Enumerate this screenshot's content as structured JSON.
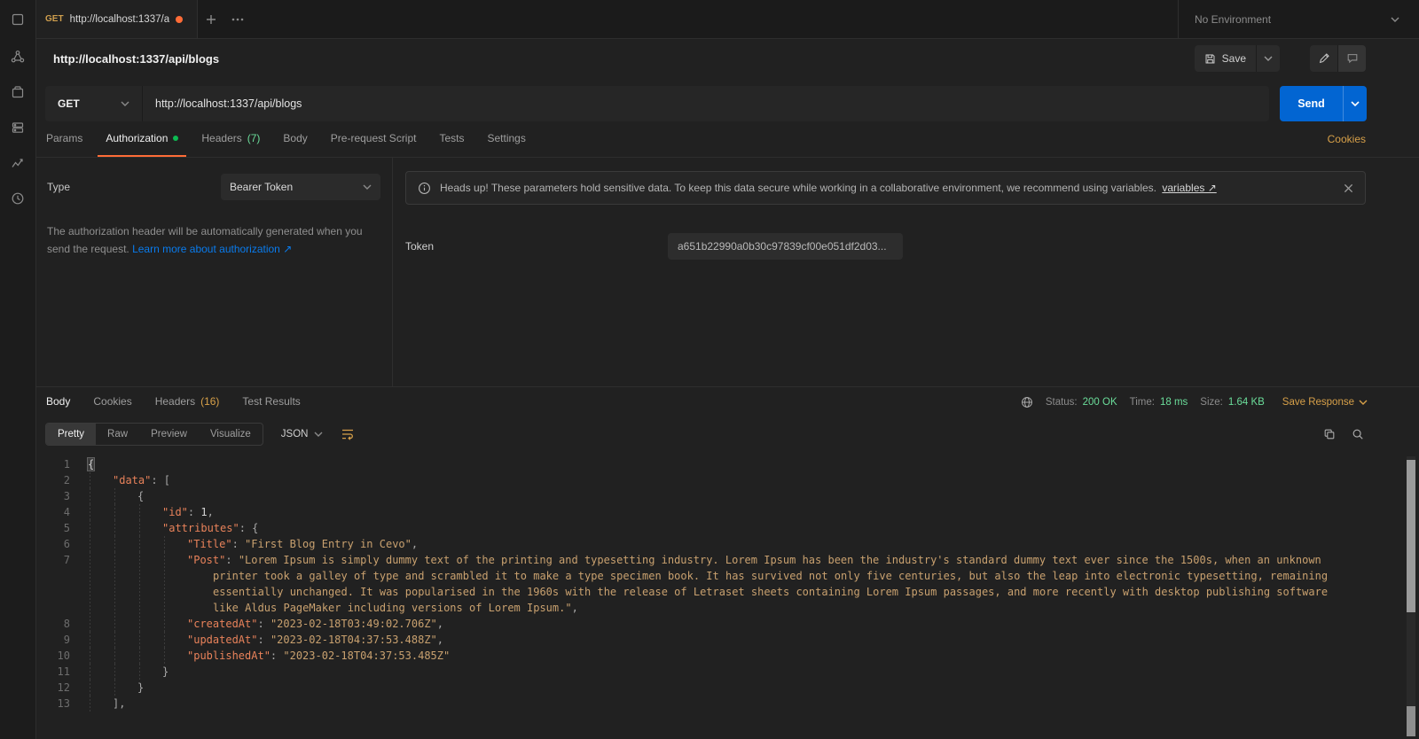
{
  "colors": {
    "accent_orange": "#ff6c37",
    "send_blue": "#0265d2",
    "status_green": "#6bdd9a",
    "link_blue": "#097bed",
    "link_amber": "#d7a049",
    "auth_dot_green": "#0cbb52"
  },
  "icons": [
    "collections-icon",
    "apis-icon",
    "environments-icon",
    "mock-servers-icon",
    "monitors-icon",
    "history-icon",
    "plus-icon",
    "more-options-icon",
    "chevron-down-icon",
    "save-icon",
    "edit-pencil-icon",
    "comments-icon",
    "info-icon",
    "close-icon",
    "globe-icon",
    "wrap-text-icon",
    "copy-icon",
    "search-icon"
  ],
  "topbar": {
    "tab_method": "GET",
    "tab_title": "http://localhost:1337/a",
    "environment": "No Environment"
  },
  "request": {
    "name": "http://localhost:1337/api/blogs",
    "save_label": "Save",
    "method": "GET",
    "url": "http://localhost:1337/api/blogs",
    "send_label": "Send",
    "tabs": {
      "params": "Params",
      "authorization": "Authorization",
      "headers": "Headers",
      "headers_count": "(7)",
      "body": "Body",
      "prerequest": "Pre-request Script",
      "tests": "Tests",
      "settings": "Settings"
    },
    "cookies_link": "Cookies"
  },
  "auth": {
    "type_label": "Type",
    "type_value": "Bearer Token",
    "description": "The authorization header will be automatically generated when you send the request.",
    "learn_more": "Learn more about authorization ↗",
    "banner": {
      "text": "Heads up! These parameters hold sensitive data. To keep this data secure while working in a collaborative environment, we recommend using variables.",
      "link": "variables ↗"
    },
    "token_label": "Token",
    "token_value": "a651b22990a0b30c97839cf00e051df2d03..."
  },
  "response": {
    "tabs": {
      "body": "Body",
      "cookies": "Cookies",
      "headers": "Headers",
      "headers_count": "(16)",
      "test_results": "Test Results"
    },
    "status_label": "Status:",
    "status_value": "200 OK",
    "time_label": "Time:",
    "time_value": "18 ms",
    "size_label": "Size:",
    "size_value": "1.64 KB",
    "save_response_label": "Save Response",
    "views": {
      "pretty": "Pretty",
      "raw": "Raw",
      "preview": "Preview",
      "visualize": "Visualize"
    },
    "format": "JSON",
    "code": [
      {
        "n": 1,
        "ind": 0,
        "toks": [
          [
            "hl",
            "{"
          ]
        ]
      },
      {
        "n": 2,
        "ind": 1,
        "toks": [
          [
            "key",
            "\"data\""
          ],
          [
            "punc",
            ": ["
          ]
        ]
      },
      {
        "n": 3,
        "ind": 2,
        "toks": [
          [
            "punc",
            "{"
          ]
        ]
      },
      {
        "n": 4,
        "ind": 3,
        "toks": [
          [
            "key",
            "\"id\""
          ],
          [
            "punc",
            ": "
          ],
          [
            "num",
            "1"
          ],
          [
            "punc",
            ","
          ]
        ]
      },
      {
        "n": 5,
        "ind": 3,
        "toks": [
          [
            "key",
            "\"attributes\""
          ],
          [
            "punc",
            ": {"
          ]
        ]
      },
      {
        "n": 6,
        "ind": 4,
        "toks": [
          [
            "key",
            "\"Title\""
          ],
          [
            "punc",
            ": "
          ],
          [
            "str",
            "\"First Blog Entry in Cevo\""
          ],
          [
            "punc",
            ","
          ]
        ]
      },
      {
        "n": 7,
        "ind": 4,
        "toks": [
          [
            "key",
            "\"Post\""
          ],
          [
            "punc",
            ": "
          ],
          [
            "str",
            "\"Lorem Ipsum is simply dummy text of the printing and typesetting industry. Lorem Ipsum has been the industry's standard dummy text ever since the 1500s, when an unknown printer took a galley of type and scrambled it to make a type specimen book. It has survived not only five centuries, but also the leap into electronic typesetting, remaining essentially unchanged. It was popularised in the 1960s with the release of Letraset sheets containing Lorem Ipsum passages, and more recently with desktop publishing software like Aldus PageMaker including versions of Lorem Ipsum.\""
          ],
          [
            "punc",
            ","
          ]
        ]
      },
      {
        "n": 8,
        "ind": 4,
        "toks": [
          [
            "key",
            "\"createdAt\""
          ],
          [
            "punc",
            ": "
          ],
          [
            "str",
            "\"2023-02-18T03:49:02.706Z\""
          ],
          [
            "punc",
            ","
          ]
        ]
      },
      {
        "n": 9,
        "ind": 4,
        "toks": [
          [
            "key",
            "\"updatedAt\""
          ],
          [
            "punc",
            ": "
          ],
          [
            "str",
            "\"2023-02-18T04:37:53.488Z\""
          ],
          [
            "punc",
            ","
          ]
        ]
      },
      {
        "n": 10,
        "ind": 4,
        "toks": [
          [
            "key",
            "\"publishedAt\""
          ],
          [
            "punc",
            ": "
          ],
          [
            "str",
            "\"2023-02-18T04:37:53.485Z\""
          ]
        ]
      },
      {
        "n": 11,
        "ind": 3,
        "toks": [
          [
            "punc",
            "}"
          ]
        ]
      },
      {
        "n": 12,
        "ind": 2,
        "toks": [
          [
            "punc",
            "}"
          ]
        ]
      },
      {
        "n": 13,
        "ind": 1,
        "toks": [
          [
            "punc",
            "],"
          ]
        ]
      }
    ]
  }
}
